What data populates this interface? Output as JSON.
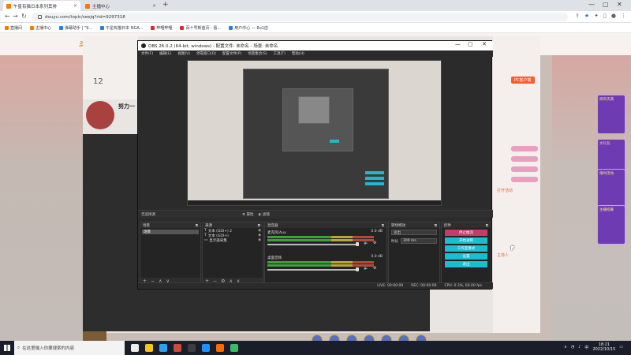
{
  "browser": {
    "tabs": [
      {
        "title": "午星有猫日本系列其排",
        "close": "×"
      },
      {
        "title": "主播中心",
        "close": "×"
      }
    ],
    "new_tab": "+",
    "window_controls": [
      "—",
      "▢",
      "✕"
    ],
    "url": "douyu.com/topic/seejq?rid=9297318",
    "bookmarks": [
      {
        "label": "直播间",
        "color": "#f57c00"
      },
      {
        "label": "主播中心",
        "color": "#f57c00"
      },
      {
        "label": "弹幕助手 | \"9...",
        "color": "#2a7de1"
      },
      {
        "label": "午星有猫日本 NGA...",
        "color": "#2a7de1"
      },
      {
        "label": "哔哩哔哩",
        "color": "#d32f2f"
      },
      {
        "label": "百十号新首页 - 看...",
        "color": "#d32f2f"
      },
      {
        "label": "用户中心 — 8u1店",
        "color": "#2a7de1"
      }
    ]
  },
  "site": {
    "logo": "斗鱼",
    "room_count": "12",
    "anchor_name": "努力一",
    "pc_button": "PC客户端",
    "ad_labels": [
      "周年庆典",
      "大礼包",
      "限时活动",
      "主播招募"
    ],
    "status_lines": [
      "打开活动",
      "主持人"
    ]
  },
  "obs": {
    "title": "OBS 26.0.2 (64-bit, windows) - 配置文件: 未命名 - 场景: 未命名",
    "menu": [
      "文件(F)",
      "编辑(E)",
      "视图(V)",
      "停靠窗口(D)",
      "配置文件(P)",
      "场景集合(S)",
      "工具(T)",
      "帮助(H)"
    ],
    "scene_bar": {
      "label": "无选择源",
      "properties": "属性",
      "filters": "滤镜"
    },
    "docks": {
      "scenes": {
        "title": "场景",
        "items": [
          "场景"
        ]
      },
      "sources": {
        "title": "来源",
        "items": [
          "文本 (GDI+) 2",
          "文本 (GDI+)",
          "显示器采集"
        ]
      },
      "mixer": {
        "title": "混音器",
        "tracks": [
          {
            "name": "麦克风/Aux",
            "db": "0.0 dB"
          },
          {
            "name": "桌面音频",
            "db": "0.0 dB"
          }
        ]
      },
      "transitions": {
        "title": "转场特效",
        "type": "淡出",
        "duration_label": "时长",
        "duration": "300 ms"
      },
      "controls": {
        "title": "控件",
        "buttons": [
          "停止推流",
          "开始录制",
          "工作室模式",
          "设置",
          "退出"
        ]
      }
    },
    "dock_footer_icons": [
      "+",
      "−",
      "⚙",
      "∧",
      "∨"
    ],
    "status": {
      "live": "LIVE: 00:00:00",
      "rec": "REC: 00:00:00",
      "cpu": "CPU: 0.3%, 60.00 fps"
    }
  },
  "taskbar": {
    "search_placeholder": "在这里输入你要搜索的内容",
    "time": "18:21",
    "date": "2022/10/15",
    "tray_lang": "中",
    "app_colors": [
      "#eee",
      "#f5c518",
      "#2ba3f2",
      "#d04a3a",
      "#3d3d3d",
      "#1e90ff",
      "#ff6a00",
      "#34c06a"
    ]
  }
}
